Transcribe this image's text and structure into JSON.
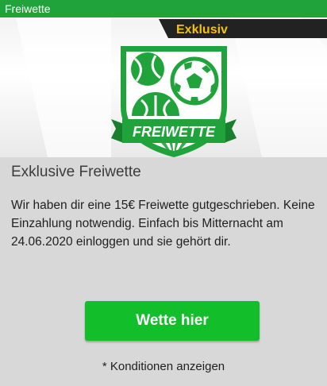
{
  "header": {
    "title": "Freiwette"
  },
  "hero": {
    "badge_label": "Exklusiv",
    "shield_banner_text": "FREIWETTE",
    "icons": [
      "tennis-ball-icon",
      "soccer-ball-icon",
      "basketball-icon"
    ],
    "colors": {
      "accent_green": "#21a33b",
      "badge_dark": "#222222",
      "badge_text": "#f5c400"
    }
  },
  "offer": {
    "title": "Exklusive Freiwette",
    "text": "Wir haben dir eine 15€ Freiwette gutgeschrieben. Keine Einzahlung notwendig. Einfach bis Mitternacht am 24.06.2020 einloggen und sie gehört dir.",
    "cta_label": "Wette hier",
    "terms_link": "* Konditionen anzeigen"
  }
}
